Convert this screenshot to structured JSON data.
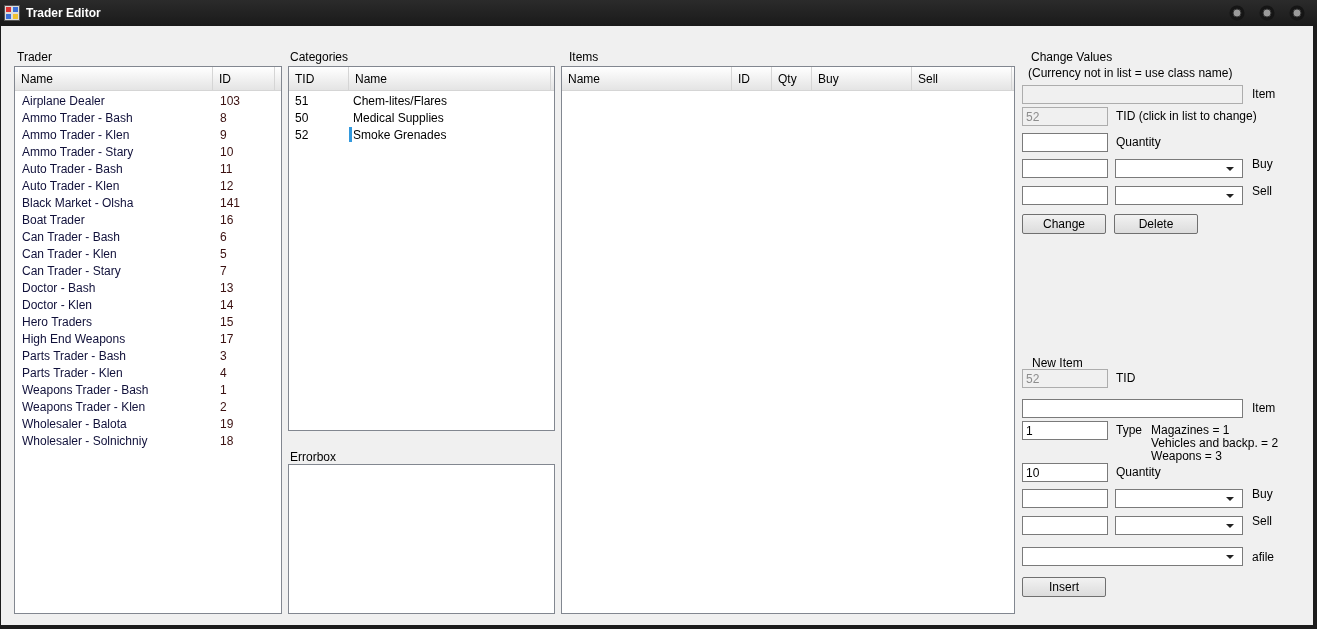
{
  "window": {
    "title": "Trader Editor"
  },
  "trader": {
    "label": "Trader",
    "columns": [
      "Name",
      "ID"
    ],
    "rows": [
      {
        "name": "Airplane Dealer",
        "id": "103"
      },
      {
        "name": "Ammo Trader - Bash",
        "id": "8"
      },
      {
        "name": "Ammo Trader - Klen",
        "id": "9"
      },
      {
        "name": "Ammo Trader - Stary",
        "id": "10"
      },
      {
        "name": "Auto Trader - Bash",
        "id": "11"
      },
      {
        "name": "Auto Trader - Klen",
        "id": "12"
      },
      {
        "name": "Black Market - Olsha",
        "id": "141"
      },
      {
        "name": "Boat Trader",
        "id": "16"
      },
      {
        "name": "Can Trader - Bash",
        "id": "6"
      },
      {
        "name": "Can Trader - Klen",
        "id": "5"
      },
      {
        "name": "Can Trader - Stary",
        "id": "7"
      },
      {
        "name": "Doctor - Bash",
        "id": "13"
      },
      {
        "name": "Doctor - Klen",
        "id": "14"
      },
      {
        "name": "Hero Traders",
        "id": "15"
      },
      {
        "name": "High End Weapons",
        "id": "17"
      },
      {
        "name": "Parts Trader - Bash",
        "id": "3"
      },
      {
        "name": "Parts Trader - Klen",
        "id": "4"
      },
      {
        "name": "Weapons Trader - Bash",
        "id": "1"
      },
      {
        "name": "Weapons Trader - Klen",
        "id": "2"
      },
      {
        "name": "Wholesaler - Balota",
        "id": "19"
      },
      {
        "name": "Wholesaler - Solnichniy",
        "id": "18"
      }
    ]
  },
  "categories": {
    "label": "Categories",
    "columns": [
      "TID",
      "Name"
    ],
    "rows": [
      {
        "tid": "51",
        "name": "Chem-lites/Flares",
        "selected": false
      },
      {
        "tid": "50",
        "name": "Medical Supplies",
        "selected": false
      },
      {
        "tid": "52",
        "name": "Smoke Grenades",
        "selected": true
      }
    ]
  },
  "errorbox": {
    "label": "Errorbox"
  },
  "items": {
    "label": "Items",
    "columns": [
      "Name",
      "ID",
      "Qty",
      "Buy",
      "Sell"
    ]
  },
  "change_values": {
    "title": "Change Values",
    "note": "(Currency not in list = use class name)",
    "rows": [
      {
        "kind": "wide",
        "label": "Item",
        "disabled": true
      },
      {
        "kind": "short",
        "value": "52",
        "label": "TID (click in list to change)",
        "disabled": true
      },
      {
        "kind": "short",
        "label": "Quantity",
        "disabled": false
      },
      {
        "kind": "pair",
        "label": "Buy"
      },
      {
        "kind": "pair",
        "label": "Sell"
      }
    ],
    "buttons": [
      "Change",
      "Delete"
    ]
  },
  "new_item": {
    "title": "New Item",
    "rows": [
      {
        "kind": "short",
        "value": "52",
        "label": "TID",
        "disabled": true
      },
      {
        "kind": "wide",
        "label": "Item",
        "disabled": false
      },
      {
        "kind": "short",
        "value": "1",
        "label": "Type",
        "disabled": false,
        "notes": [
          "Magazines = 1",
          "Vehicles and backp. = 2",
          "Weapons = 3"
        ]
      },
      {
        "kind": "short",
        "value": "10",
        "label": "Quantity",
        "disabled": false
      },
      {
        "kind": "pair",
        "label": "Buy"
      },
      {
        "kind": "pair",
        "label": "Sell"
      },
      {
        "kind": "wide_combo",
        "label": "afile"
      }
    ],
    "buttons": [
      "Insert"
    ]
  }
}
